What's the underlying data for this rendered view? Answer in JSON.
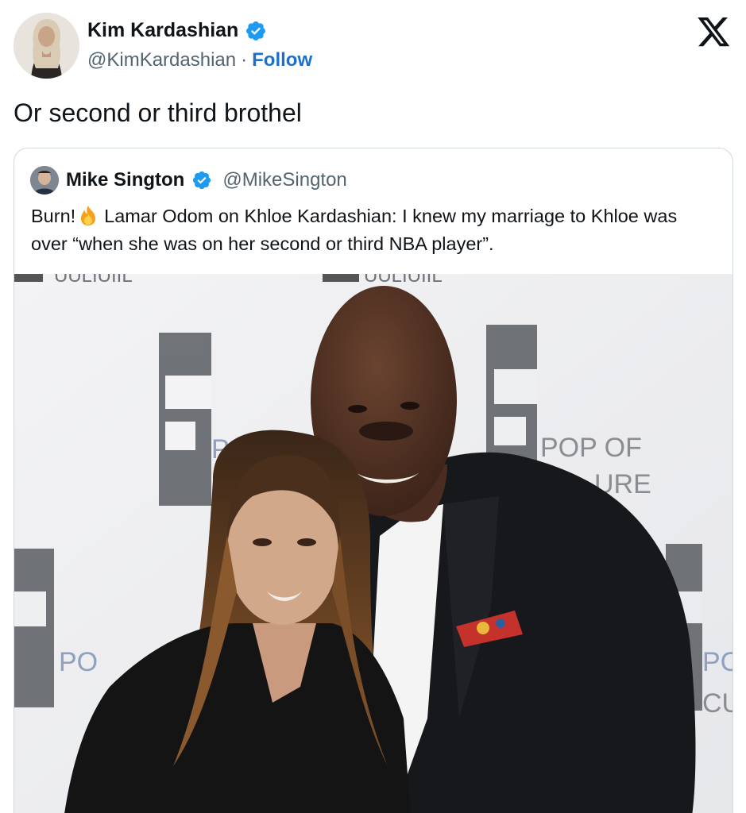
{
  "tweet": {
    "author_name": "Kim Kardashian",
    "author_handle": "@KimKardashian",
    "separator": "·",
    "follow_label": "Follow",
    "text": "Or second or third brothel"
  },
  "quoted_tweet": {
    "author_name": "Mike Sington",
    "author_handle": "@MikeSington",
    "text_before_emoji": "Burn!",
    "text_after_emoji": "Lamar Odom on Khloe Kardashian: I knew my marriage to Khloe was over “when she was on her second or third NBA player”."
  },
  "photo": {
    "backdrop_text_1": "POP OF",
    "backdrop_text_2": "URE",
    "backdrop_text_3": "PO",
    "backdrop_text_4": "CU",
    "backdrop_text_5": "PC",
    "backdrop_text_6": "PO",
    "backdrop_top_left": "UULIUIIL",
    "backdrop_top_mid": "UULIUIIL"
  },
  "icons": {
    "verified": "verified-badge-icon",
    "platform": "x-logo-icon",
    "emoji": "fire-emoji-icon"
  },
  "colors": {
    "link_blue": "#1d70c9",
    "verified_blue": "#1d9bf0",
    "text_primary": "#0f1419",
    "text_secondary": "#536471",
    "border": "#cfd9de"
  }
}
